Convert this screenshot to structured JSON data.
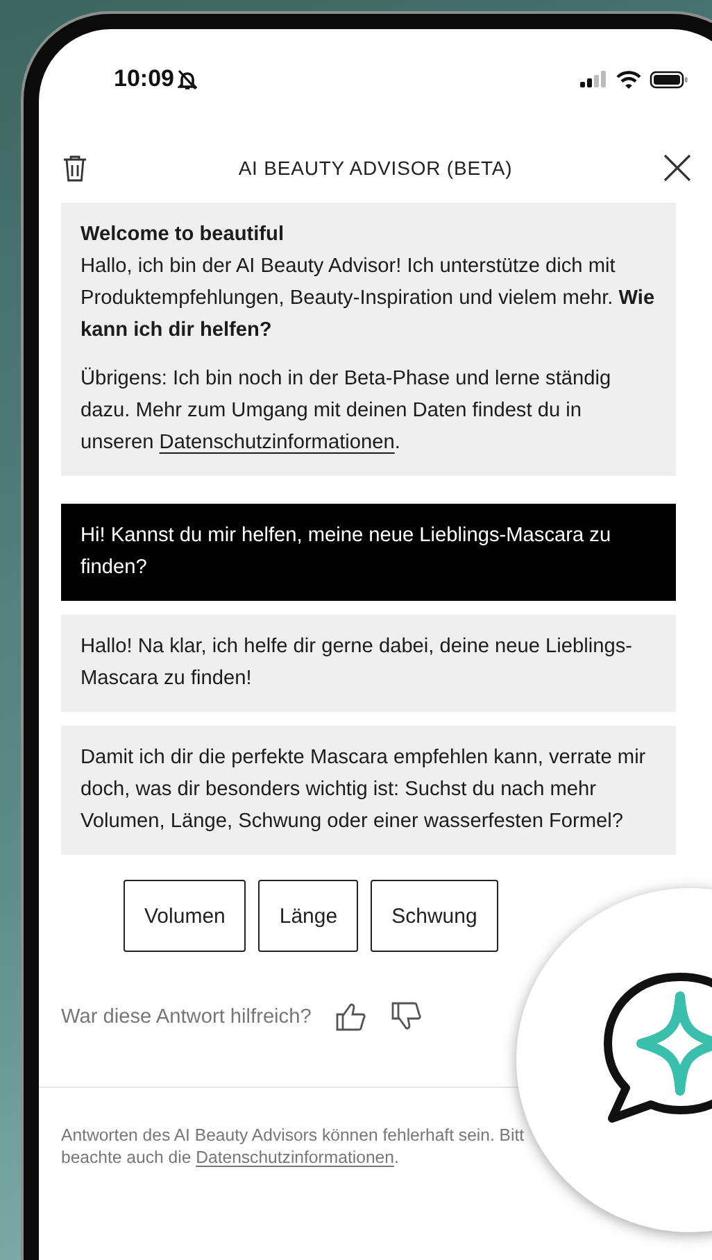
{
  "status_bar": {
    "time": "10:09",
    "silent": true
  },
  "header": {
    "title": "AI BEAUTY ADVISOR (BETA)"
  },
  "messages": [
    {
      "kind": "bot",
      "heading": "Welcome to beautiful",
      "paragraphs": [
        {
          "text": "Hallo, ich bin der AI Beauty Advisor! Ich unterstütze dich mit Produktempfehlungen, Beauty-Inspiration und vielem mehr. **Wie kann ich dir helfen?**"
        },
        {
          "text": "Übrigens: Ich bin noch in der Beta-Phase und lerne ständig dazu. Mehr zum Umgang mit deinen Daten findest du in unseren ",
          "link": "Datenschutzinformationen",
          "after": "."
        }
      ]
    },
    {
      "kind": "user",
      "paragraphs": [
        {
          "text": "Hi! Kannst du mir helfen, meine neue Lieblings-Mascara zu finden?"
        }
      ]
    },
    {
      "kind": "bot",
      "paragraphs": [
        {
          "text": "Hallo! Na klar, ich helfe dir gerne dabei, deine neue Lieblings-Mascara zu finden!"
        }
      ]
    },
    {
      "kind": "bot",
      "paragraphs": [
        {
          "text": "Damit ich dir die perfekte Mascara empfehlen kann, verrate mir doch, was dir besonders wichtig ist: Suchst du nach mehr Volumen, Länge, Schwung oder einer wasserfesten Formel?"
        }
      ]
    }
  ],
  "quick_replies": [
    "Volumen",
    "Länge",
    "Schwung"
  ],
  "feedback": {
    "question": "War diese Antwort hilfreich?"
  },
  "footer": {
    "text": "Antworten des AI Beauty Advisors können fehlerhaft sein. Bitt",
    "text_2": "beachte auch die ",
    "link": "Datenschutzinformationen",
    "after": "."
  }
}
